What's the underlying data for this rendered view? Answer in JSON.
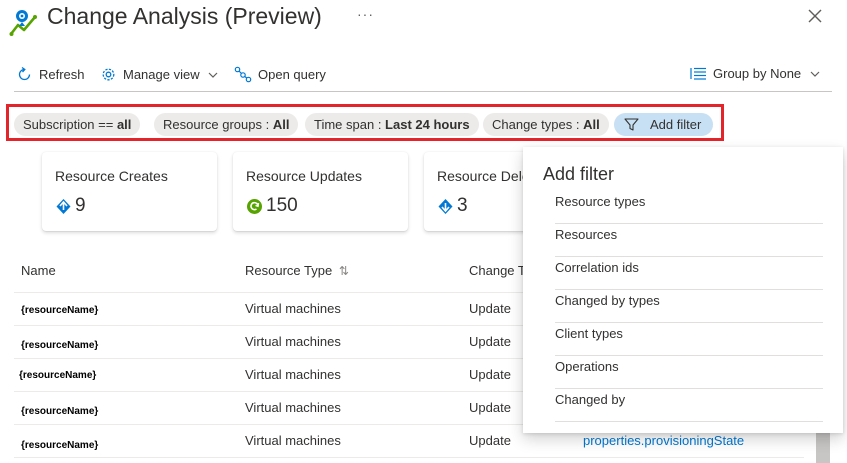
{
  "header": {
    "title": "Change Analysis (Preview)",
    "more": "···",
    "close_icon": "close-icon"
  },
  "toolbar": {
    "refresh": "Refresh",
    "manage_view": "Manage view",
    "open_query": "Open query",
    "group_by": "Group by None"
  },
  "filters": {
    "subscription_label": "Subscription == ",
    "subscription_value": "all",
    "resource_groups_label": "Resource groups : ",
    "resource_groups_value": "All",
    "time_span_label": "Time span : ",
    "time_span_value": "Last 24 hours",
    "change_types_label": "Change types : ",
    "change_types_value": "All",
    "add_filter": "Add filter"
  },
  "cards": [
    {
      "title": "Resource Creates",
      "value": "9",
      "icon": "create-icon",
      "color": "#0078d4"
    },
    {
      "title": "Resource Updates",
      "value": "150",
      "icon": "update-icon",
      "color": "#57a300"
    },
    {
      "title": "Resource Dele",
      "value": "3",
      "icon": "delete-icon",
      "color": "#0078d4"
    }
  ],
  "table": {
    "headers": [
      "Name",
      "Resource Type",
      "Change T"
    ],
    "rows": [
      {
        "name": "{resourceName}",
        "type": "Virtual machines",
        "change": "Update",
        "property": ""
      },
      {
        "name": "{resourceName}",
        "type": "Virtual machines",
        "change": "Update",
        "property": ""
      },
      {
        "name": "{resourceName}",
        "type": "Virtual machines",
        "change": "Update",
        "property": ""
      },
      {
        "name": "{resourceName}",
        "type": "Virtual machines",
        "change": "Update",
        "property": ""
      },
      {
        "name": "{resourceName}",
        "type": "Virtual machines",
        "change": "Update",
        "property": "properties.provisioningState"
      }
    ]
  },
  "dropdown": {
    "title": "Add filter",
    "items": [
      "Resource types",
      "Resources",
      "Correlation ids",
      "Changed by types",
      "Client types",
      "Operations",
      "Changed by"
    ]
  },
  "colors": {
    "accent": "#0078d4",
    "highlight_border": "#e3242b",
    "pill": "#edebe9",
    "pill_active": "#c7e0f4"
  }
}
